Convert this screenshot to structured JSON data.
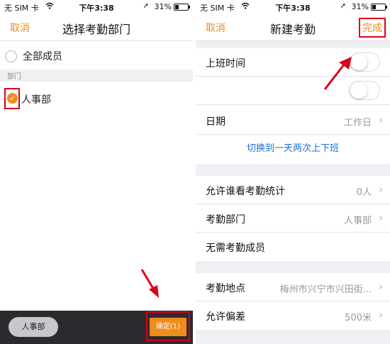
{
  "left_screen": {
    "status": {
      "carrier": "无 SIM 卡",
      "time": "下午3:38",
      "battery": "31%",
      "battery_level": 0.31
    },
    "nav": {
      "cancel": "取消",
      "title": "选择考勤部门"
    },
    "all_members": "全部成员",
    "section_header": "部门",
    "department": {
      "name": "人事部",
      "checked": true
    },
    "bottom": {
      "selected_chip": "人事部",
      "confirm": "确定(1)"
    }
  },
  "right_screen": {
    "status": {
      "carrier": "无 SIM 卡",
      "time": "下午3:38",
      "battery": "31%",
      "battery_level": 0.31
    },
    "nav": {
      "cancel": "取消",
      "title": "新建考勤",
      "done": "完成"
    },
    "work_time": {
      "label": "上班时间"
    },
    "date": {
      "label": "日期",
      "value": "工作日"
    },
    "switch_link": "切换到一天两次上下班",
    "stats_viewers": {
      "label": "允许谁看考勤统计",
      "value": "0人"
    },
    "department": {
      "label": "考勤部门",
      "value": "人事部"
    },
    "exempt": {
      "label": "无需考勤成员"
    },
    "location": {
      "label": "考勤地点",
      "value": "梅州市兴宁市兴田街..."
    },
    "deviation": {
      "label": "允许偏差",
      "value": "500米"
    }
  },
  "colors": {
    "accent": "#f08c1e",
    "annotation": "#d9001b",
    "link": "#1e6fd0"
  },
  "icons": {
    "check": "check-icon",
    "chevron": "chevron-right-icon",
    "wifi": "wifi-icon",
    "location": "location-arrow-icon"
  }
}
